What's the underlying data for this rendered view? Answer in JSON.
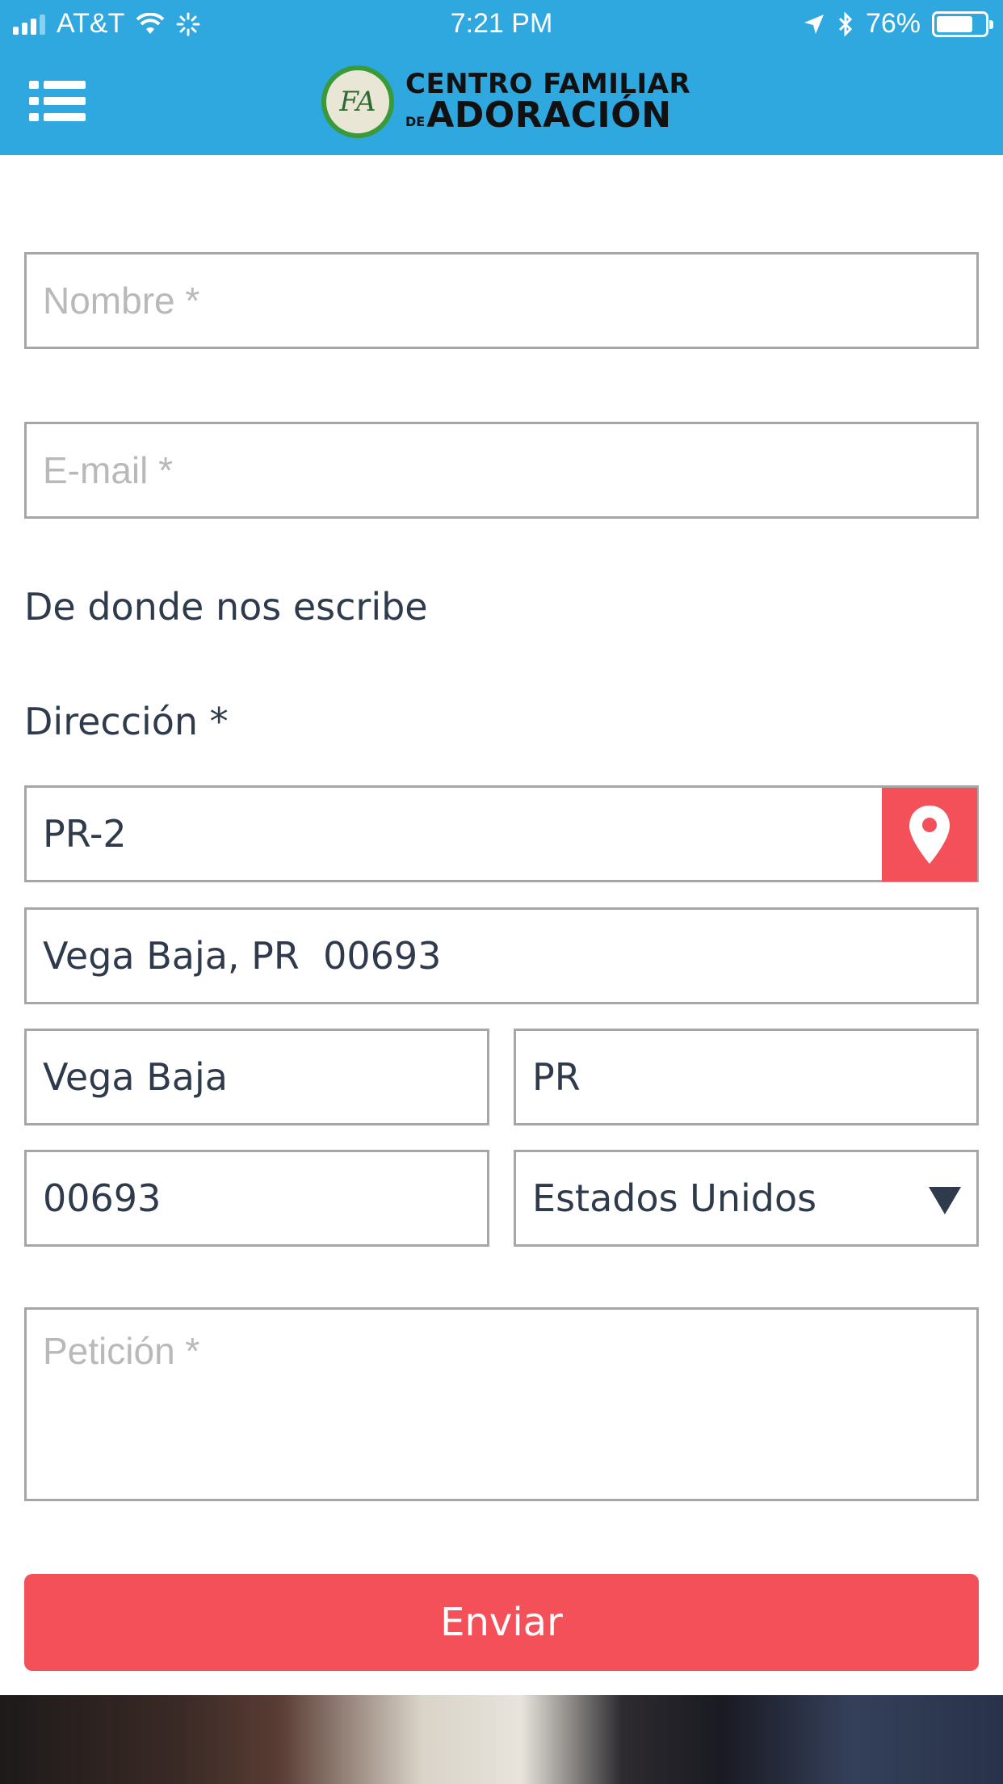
{
  "status_bar": {
    "carrier": "AT&T",
    "time": "7:21 PM",
    "battery": "76%",
    "battery_level": 0.76
  },
  "header": {
    "logo_line1": "CENTRO FAMILIAR",
    "logo_small": "DE",
    "logo_line2": "ADORACIÓN",
    "logo_mark": "FA"
  },
  "form": {
    "name_placeholder": "Nombre *",
    "email_placeholder": "E-mail *",
    "section_label": "De donde nos escribe",
    "address_label": "Dirección *",
    "street_value": "PR-2",
    "city_state_zip_value": "Vega Baja, PR  00693",
    "city_value": "Vega Baja",
    "state_value": "PR",
    "zip_value": "00693",
    "country_value": "Estados Unidos",
    "petition_placeholder": "Petición *",
    "submit_label": "Enviar"
  },
  "colors": {
    "header_bg": "#2fa7df",
    "accent": "#f4505a",
    "text": "#2f3b4c"
  }
}
